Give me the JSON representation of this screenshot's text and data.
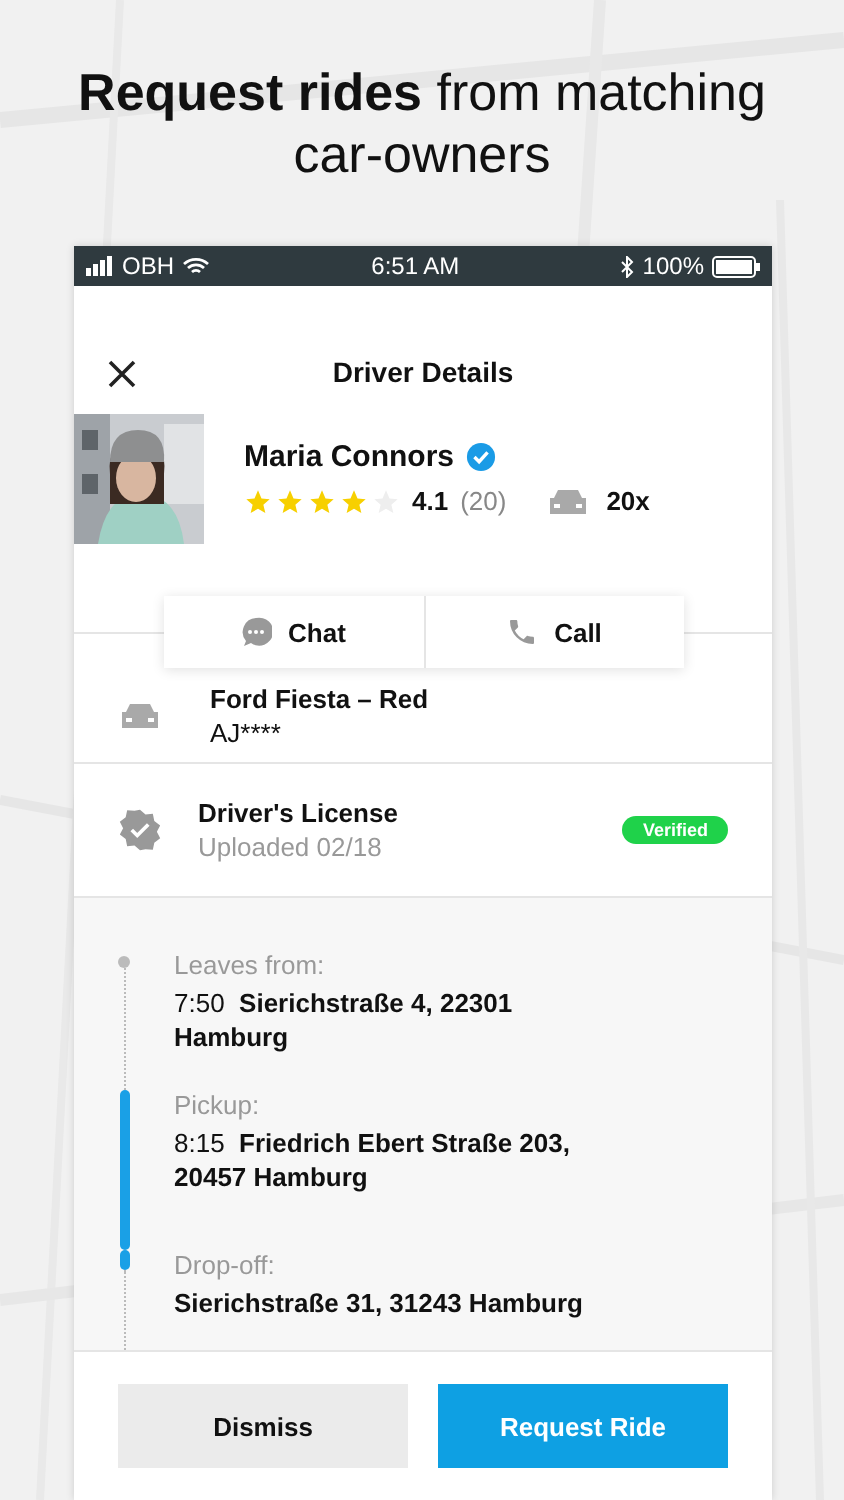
{
  "headline": "**Request rides** from matching car-owners",
  "status_bar": {
    "carrier": "OBH",
    "time": "6:51 AM",
    "battery": "100%"
  },
  "header": {
    "title": "Driver Details"
  },
  "driver": {
    "name": "Maria Connors",
    "verified": true,
    "stars": 4,
    "rating": "4.1",
    "reviews": "(20)",
    "rides": "20x"
  },
  "contact_buttons": [
    "Chat",
    "Call"
  ],
  "car": {
    "model": "Ford Fiesta – Red",
    "plate": "AJ****"
  },
  "license": {
    "title": "Driver's License",
    "subtitle": "Uploaded 02/18",
    "badge": "Verified",
    "verified": true
  },
  "stops": [
    {
      "label": "Leaves from:",
      "time": "7:50",
      "address": "Sierichstraße 4, 22301 Hamburg",
      "in_ride": false
    },
    {
      "label": "Pickup:",
      "time": "8:15",
      "address": "Friedrich Ebert Straße 203, 20457 Hamburg",
      "in_ride": true
    },
    {
      "label": "Drop-off:",
      "address": "Sierichstraße 31, 31243 Hamburg",
      "in_ride": true
    }
  ],
  "actions": [
    {
      "label": "Dismiss",
      "kind": "secondary"
    },
    {
      "label": "Request Ride",
      "kind": "primary"
    }
  ]
}
